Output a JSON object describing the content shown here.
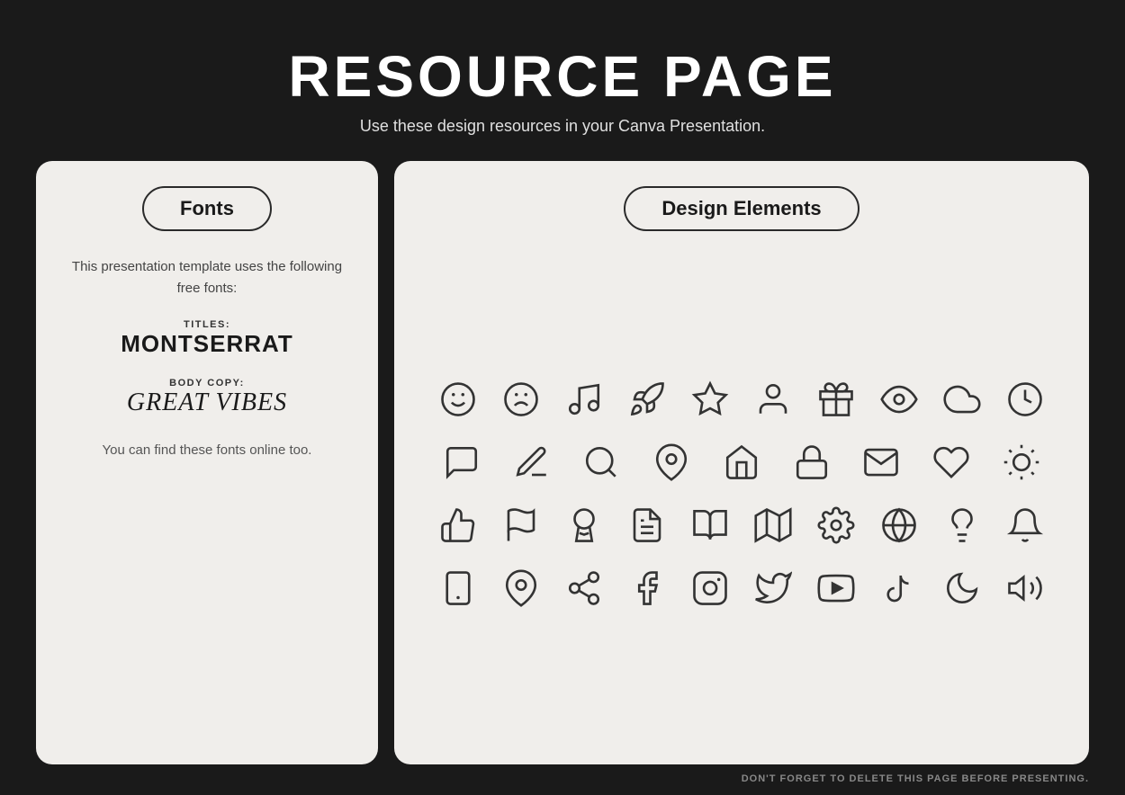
{
  "header": {
    "title": "RESOURCE PAGE",
    "subtitle": "Use these design resources in your Canva Presentation."
  },
  "fonts_panel": {
    "title": "Fonts",
    "description": "This presentation template uses the following free fonts:",
    "titles_label": "TITLES:",
    "titles_font": "MONTSERRAT",
    "body_label": "BODY COPY:",
    "body_font": "GREAT VIBES",
    "footer_text": "You can find these fonts online too."
  },
  "design_panel": {
    "title": "Design Elements"
  },
  "footer": {
    "note": "DON'T FORGET TO DELETE THIS PAGE BEFORE PRESENTING."
  }
}
